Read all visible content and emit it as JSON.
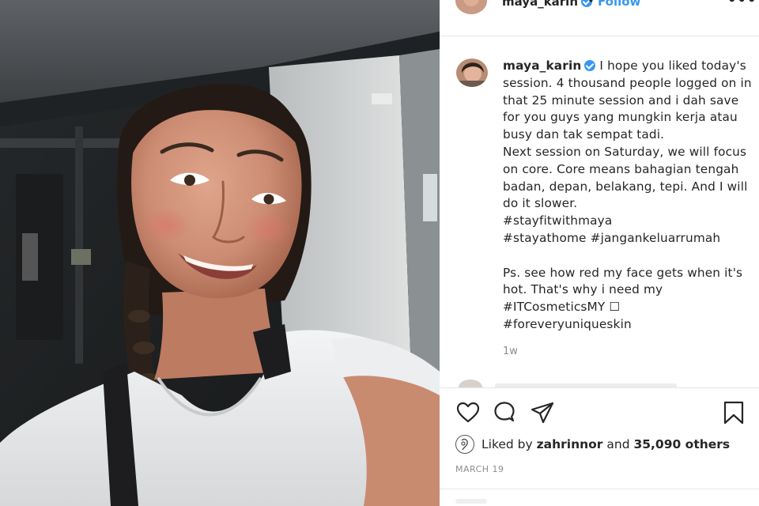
{
  "post": {
    "username": "maya_karin",
    "follow_label": "Follow",
    "separator": "•",
    "more_label": "•••",
    "caption_pre": " I hope you liked today's session. 4 thousand people logged on in that 25 minute session and i dah save for you guys yang mungkin kerja atau busy dan tak sempat tadi.\nNext session on Saturday, we will focus on core. Core means bahagian tengah badan, depan, belakang, tepi. And I will do it slower.\n",
    "tags_1": "#stayfitwithmaya",
    "tags_2": "#stayathome #jangankeluarrumah",
    "caption_post": "\n\nPs. see how red my face gets when it's hot. That's why i need my\n",
    "tag_brand": "#ITCosmeticsMY",
    "brand_glyph": " ☐",
    "tag_skin": "#foreveryuniqueskin",
    "timestamp": "1w",
    "likes_prefix": "Liked by ",
    "likes_user": "zahrinnor",
    "likes_mid": " and ",
    "likes_count": "35,090 others",
    "date": "MARCH 19"
  },
  "icons": {
    "like": "heart-icon",
    "comment": "comment-bubble-icon",
    "share": "paper-plane-icon",
    "save": "bookmark-icon",
    "verified": "verified-badge-icon",
    "likes_avatar": "likes-avatar-icon"
  },
  "colors": {
    "accent": "#3897f0",
    "text": "#262626",
    "muted": "#8e8e8e",
    "divider": "#e6e6e6"
  }
}
